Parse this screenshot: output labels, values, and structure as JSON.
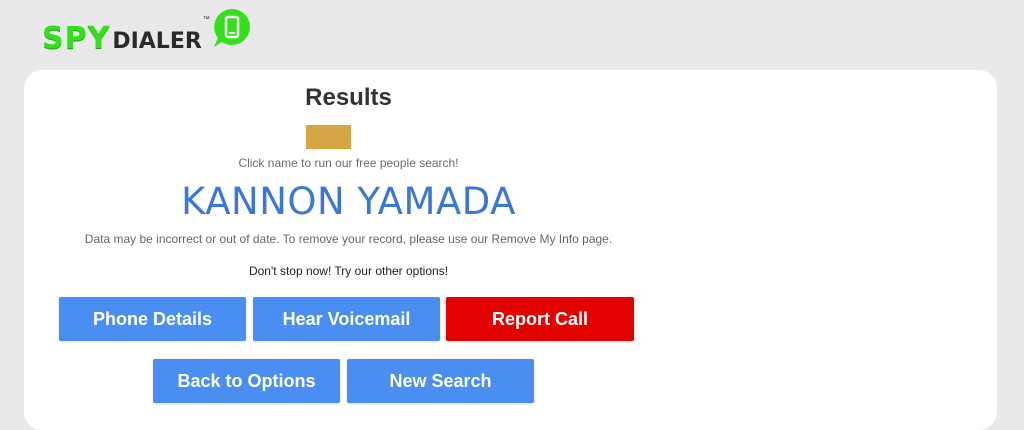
{
  "logo": {
    "part1": "SPY",
    "part2": "DIALER",
    "tm": "™"
  },
  "results": {
    "title": "Results",
    "hint": "Click name to run our free people search!",
    "name": "KANNON YAMADA",
    "disclaimer": "Data may be incorrect or out of date. To remove your record, please use our Remove My Info page.",
    "cta": "Don't stop now! Try our other options!"
  },
  "buttons": {
    "phone_details": "Phone Details",
    "hear_voicemail": "Hear Voicemail",
    "report_call": "Report Call",
    "back_to_options": "Back to Options",
    "new_search": "New Search"
  },
  "colors": {
    "brand_green": "#33e01b",
    "link_blue": "#3a78d8",
    "button_blue": "#4a8ef2",
    "button_red": "#e20000",
    "badge": "#d6a645",
    "page_bg": "#e9e9ec"
  }
}
